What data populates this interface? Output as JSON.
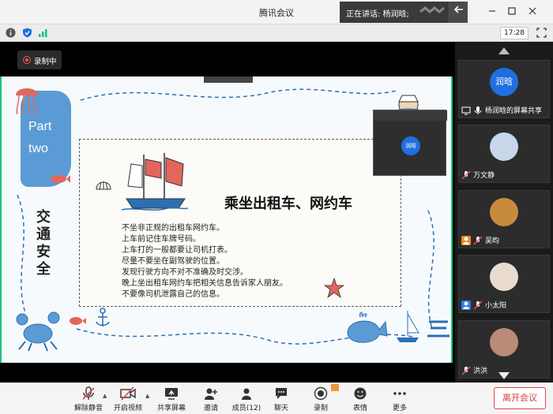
{
  "window": {
    "title": "腾讯会议"
  },
  "speaker_banner": {
    "text": "正在讲话: 杨润晗;"
  },
  "status": {
    "time": "17:28"
  },
  "recording": {
    "label": "录制中"
  },
  "slide": {
    "part_line1": "Part",
    "part_line2": "two",
    "vertical_title": "交通安全",
    "heading": "乘坐出租车、网约车",
    "lines": [
      "不坐非正规的出租车网约车。",
      "上车前记住车牌号码。",
      "上车打的一般都要让司机打表。",
      "尽量不要坐在副驾驶的位置。",
      "发现行驶方向不对不准确及时交涉。",
      "晚上坐出租车网约车把相关信息告诉家人朋友。",
      "不要像司机泄露自己的信息。"
    ]
  },
  "pip": {
    "avatar_text": "润晗"
  },
  "participants": [
    {
      "name": "杨润晗的屏幕共享",
      "avatar_text": "润晗",
      "avatar_color": "#1f6fe0"
    },
    {
      "name": "万文静",
      "avatar_color": "#c7d6e8"
    },
    {
      "name": "吴昀",
      "avatar_color": "#c88a3c"
    },
    {
      "name": "小太阳",
      "avatar_color": "#e9dccf"
    },
    {
      "name": "洪洪",
      "avatar_color": "#b98b78"
    }
  ],
  "toolbar": {
    "mute": "解除静音",
    "video": "开启视频",
    "share": "共享屏幕",
    "invite": "邀请",
    "members": "成员(12)",
    "chat": "聊天",
    "record": "录制",
    "reactions": "表情",
    "more": "更多",
    "leave": "离开会议"
  },
  "colors": {
    "accent_green": "#19c37a",
    "leave_red": "#d93a3a",
    "slide_blue": "#5b9bd5"
  }
}
